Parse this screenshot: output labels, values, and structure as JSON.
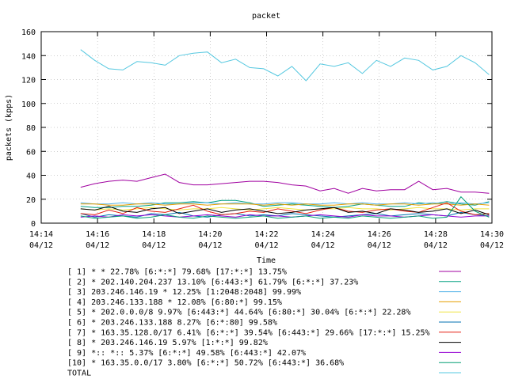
{
  "chart_data": {
    "type": "line",
    "title": "packet",
    "xlabel": "Time",
    "ylabel": "packets (kpps)",
    "ylim": [
      0,
      160
    ],
    "yticks": [
      0,
      20,
      40,
      60,
      80,
      100,
      120,
      140,
      160
    ],
    "xlim_minutes": [
      0,
      16
    ],
    "xtick_minutes": [
      0,
      2,
      4,
      6,
      8,
      10,
      12,
      14,
      16
    ],
    "xtick_labels": [
      [
        "14:14",
        "04/12"
      ],
      [
        "14:16",
        "04/12"
      ],
      [
        "14:18",
        "04/12"
      ],
      [
        "14:20",
        "04/12"
      ],
      [
        "14:22",
        "04/12"
      ],
      [
        "14:24",
        "04/12"
      ],
      [
        "14:26",
        "04/12"
      ],
      [
        "14:28",
        "04/12"
      ],
      [
        "14:30",
        "04/12"
      ]
    ],
    "grid": true,
    "legend_position": "bottom",
    "x": [
      1.4,
      1.9,
      2.4,
      2.9,
      3.4,
      3.9,
      4.4,
      4.9,
      5.4,
      5.9,
      6.4,
      6.9,
      7.4,
      7.9,
      8.4,
      8.9,
      9.4,
      9.9,
      10.4,
      10.9,
      11.4,
      11.9,
      12.4,
      12.9,
      13.4,
      13.9,
      14.4,
      14.9,
      15.4,
      15.9
    ],
    "series": [
      {
        "name": "[ 1] * * 22.78%  [6:*:*] 79.68% [17:*:*] 13.75%",
        "color": "#a000a0",
        "values": [
          30,
          33,
          35,
          36,
          35,
          38,
          41,
          34,
          32,
          32,
          33,
          34,
          35,
          35,
          34,
          32,
          31,
          27,
          29,
          25,
          29,
          27,
          28,
          28,
          35,
          28,
          29,
          26,
          26,
          25
        ]
      },
      {
        "name": "[ 2] * 202.140.204.237 13.10%  [6:443:*] 61.79% [6:*:*] 37.23%",
        "color": "#00a080",
        "values": [
          14,
          13,
          13,
          14,
          14,
          15,
          17,
          17,
          18,
          17,
          19,
          19,
          17,
          14,
          15,
          16,
          15,
          14,
          13,
          14,
          16,
          15,
          14,
          14,
          17,
          16,
          18,
          16,
          15,
          18
        ]
      },
      {
        "name": "[ 3] 203.246.146.19 * 12.25%  [1:2048:2048] 99.99%",
        "color": "#56b4e9",
        "values": [
          17,
          16,
          16,
          17,
          16,
          17,
          16,
          16,
          17,
          17,
          16,
          17,
          16,
          16,
          17,
          17,
          16,
          16,
          17,
          16,
          17,
          16,
          16,
          17,
          16,
          17,
          16,
          17,
          16,
          17
        ]
      },
      {
        "name": "[ 4] 203.246.133.188 * 12.08%  [6:80:*] 99.15%",
        "color": "#e69f00",
        "values": [
          16,
          16,
          15,
          15,
          16,
          16,
          15,
          16,
          16,
          15,
          16,
          16,
          16,
          15,
          16,
          15,
          16,
          15,
          15,
          16,
          16,
          15,
          16,
          16,
          15,
          16,
          16,
          15,
          16,
          15
        ]
      },
      {
        "name": "[ 5] * 202.0.0.0/8 9.97%  [6:443:*] 44.64% [6:80:*] 30.04% [6:*:*] 22.28%",
        "color": "#f0e442",
        "values": [
          12,
          11,
          12,
          11,
          12,
          13,
          12,
          11,
          12,
          12,
          13,
          12,
          11,
          12,
          13,
          12,
          11,
          12,
          12,
          13,
          12,
          12,
          11,
          12,
          13,
          12,
          12,
          11,
          12,
          12
        ]
      },
      {
        "name": "[ 6] * 203.246.133.188 8.27%  [6:*:80] 99.58%",
        "color": "#0072b2",
        "values": [
          8,
          5,
          7,
          6,
          5,
          8,
          7,
          9,
          6,
          5,
          7,
          8,
          6,
          7,
          6,
          8,
          7,
          6,
          5,
          6,
          7,
          8,
          6,
          7,
          8,
          7,
          6,
          9,
          7,
          6
        ]
      },
      {
        "name": "[ 7] * 163.35.128.0/17 6.41%  [6:*:*] 39.54% [6:443:*] 29.66% [17:*:*] 15.25%",
        "color": "#e51e10",
        "values": [
          8,
          7,
          11,
          8,
          13,
          10,
          9,
          12,
          15,
          10,
          7,
          8,
          10,
          9,
          12,
          10,
          8,
          11,
          13,
          10,
          9,
          11,
          12,
          10,
          9,
          13,
          17,
          10,
          7,
          8
        ]
      },
      {
        "name": "[ 8] * 203.246.146.19 5.97%  [1:*:*] 99.82%",
        "color": "#000000",
        "values": [
          12,
          11,
          14,
          10,
          9,
          12,
          13,
          8,
          10,
          12,
          9,
          11,
          12,
          10,
          8,
          9,
          11,
          12,
          13,
          9,
          10,
          8,
          12,
          11,
          9,
          10,
          12,
          8,
          11,
          7
        ]
      },
      {
        "name": "[ 9] *:: *:: 5.37%  [6:*:*] 49.58% [6:443:*] 42.07%",
        "color": "#9400d3",
        "values": [
          5,
          6,
          5,
          7,
          6,
          7,
          6,
          5,
          6,
          7,
          6,
          5,
          7,
          6,
          6,
          5,
          6,
          7,
          6,
          5,
          7,
          6,
          6,
          5,
          6,
          7,
          6,
          5,
          6,
          6
        ]
      },
      {
        "name": "[10] * 163.35.0.0/17 3.80%  [6:*:*] 50.72% [6:443:*] 36.68%",
        "color": "#009e73",
        "values": [
          6,
          4,
          5,
          6,
          4,
          5,
          7,
          5,
          4,
          6,
          5,
          4,
          5,
          6,
          4,
          5,
          6,
          4,
          5,
          4,
          6,
          5,
          4,
          5,
          6,
          4,
          5,
          22,
          10,
          5
        ]
      },
      {
        "name": "TOTAL",
        "color": "#56c8e0",
        "values": [
          145,
          136,
          129,
          128,
          135,
          134,
          132,
          140,
          142,
          143,
          134,
          137,
          130,
          129,
          123,
          131,
          119,
          133,
          131,
          134,
          125,
          136,
          131,
          138,
          136,
          128,
          131,
          140,
          134,
          124
        ]
      }
    ]
  }
}
